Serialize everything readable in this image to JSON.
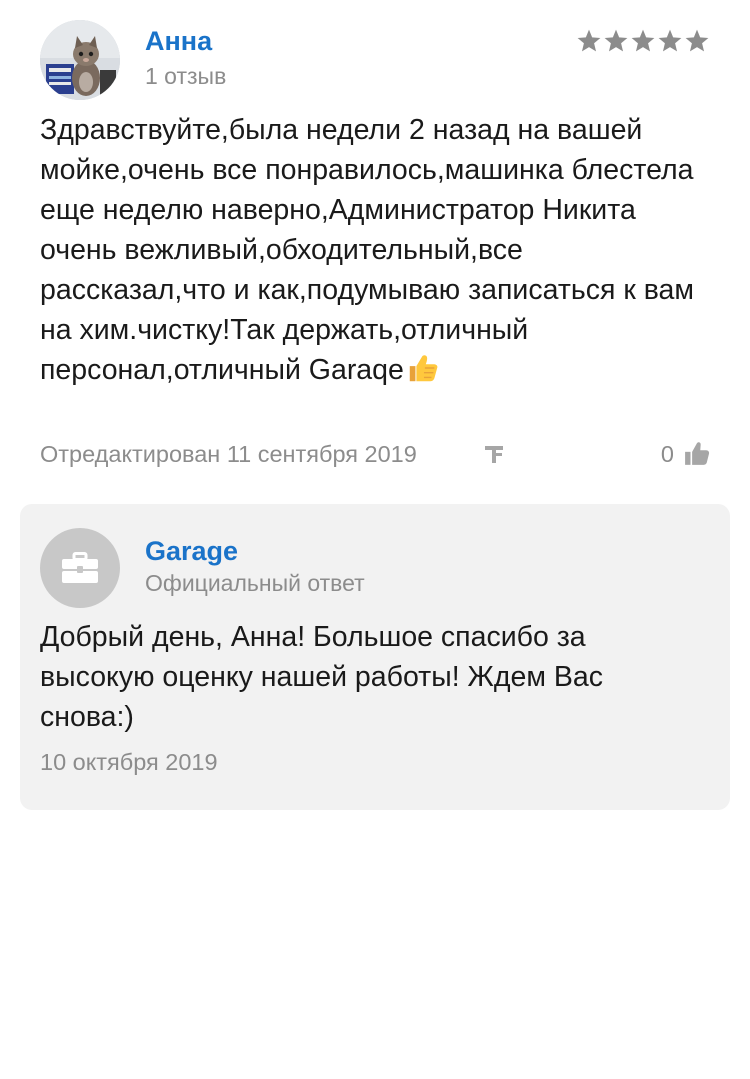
{
  "review": {
    "author": {
      "name": "Анна",
      "reviews_count": "1 отзыв",
      "avatar": "cat-photo-avatar"
    },
    "rating": 5,
    "rating_max": 5,
    "star_color": "#8c8c8c",
    "text": "Здравствуйте,была недели 2 назад на вашей мойке,очень все понравилось,машинка блестела еще неделю наверно,Администратор Никита очень вежливый,обходительный,все рассказал,что и как,подумываю записаться к вам на хим.чистку!Так держать,отличный персонал,отличный Garaqe",
    "emoji": "thumbs-up-emoji",
    "edited_date": "Отредактирован 11 сентября 2019",
    "source_icon": "flamp-icon",
    "likes": "0"
  },
  "reply": {
    "name": "Garage",
    "label": "Официальный ответ",
    "avatar": "briefcase-icon",
    "text": "Добрый день, Анна! Большое спасибо за высокую оценку нашей работы! Ждем Вас снова:)",
    "date": "10 октября 2019"
  },
  "colors": {
    "link_blue": "#1a73c9",
    "muted_gray": "#8c8c8c",
    "reply_bg": "#f2f2f2"
  }
}
